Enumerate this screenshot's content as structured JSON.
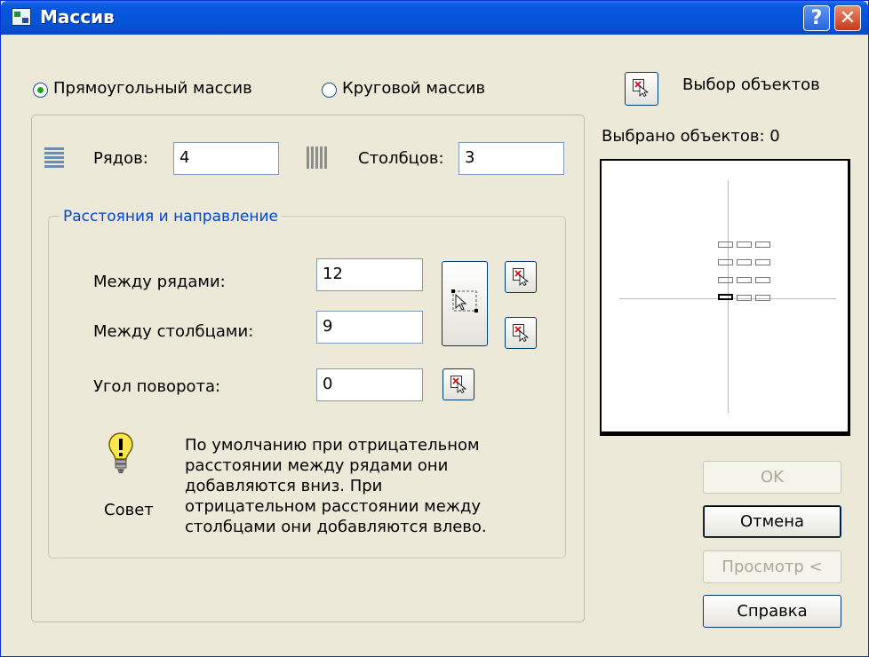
{
  "window": {
    "title": "Массив",
    "icons": {
      "app": "array-app-icon",
      "help": "help-icon",
      "close": "close-icon"
    },
    "help_glyph": "?",
    "close_glyph": "✕"
  },
  "array_type": {
    "rectangular_label": "Прямоугольный массив",
    "polar_label": "Круговой массив",
    "selected": "rectangular"
  },
  "select_objects": {
    "label": "Выбор объектов",
    "selected_count_label": "Выбрано объектов: 0"
  },
  "grid": {
    "rows_label": "Рядов:",
    "rows_value": "4",
    "cols_label": "Столбцов:",
    "cols_value": "3"
  },
  "offset": {
    "legend": "Расстояния и направление",
    "row_offset_label": "Между рядами:",
    "row_offset_value": "12",
    "col_offset_label": "Между столбцами:",
    "col_offset_value": "9",
    "angle_label": "Угол поворота:",
    "angle_value": "0"
  },
  "tip": {
    "label": "Совет",
    "text_lines": [
      "По умолчанию при отрицательном",
      "расстоянии между рядами они",
      "добавляются вниз. При",
      "отрицательном расстоянии между",
      "столбцами они добавляются влево."
    ]
  },
  "buttons": {
    "ok": "OK",
    "cancel": "Отмена",
    "preview": "Просмотр <",
    "help": "Справка"
  },
  "colors": {
    "title_bar": "#0654dc",
    "dialog_bg": "#ece9d8",
    "legend_text": "#0046d5",
    "radio_dot": "#21a121"
  }
}
